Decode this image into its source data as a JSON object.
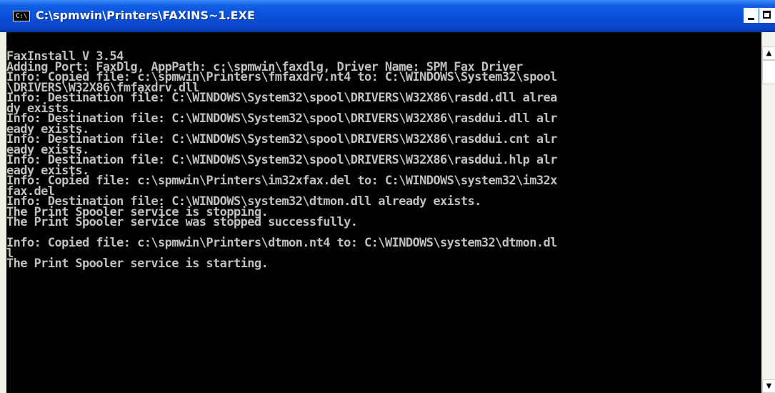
{
  "window": {
    "title": "C:\\spmwin\\Printers\\FAXINS~1.EXE",
    "icon_text": "C:\\",
    "controls": {
      "minimize": "minimize",
      "maximize": "maximize",
      "close": "close"
    }
  },
  "console": {
    "lines": [
      "FaxInstall V 3.54",
      "Adding Port: FaxDlg, AppPath: c:\\spmwin\\faxdlg, Driver Name: SPM Fax Driver",
      "Info: Copied file: c:\\spmwin\\Printers\\fmfaxdrv.nt4 to: C:\\WINDOWS\\System32\\spool",
      "\\DRIVERS\\W32X86\\fmfaxdrv.dll",
      "Info: Destination file: C:\\WINDOWS\\System32\\spool\\DRIVERS\\W32X86\\rasdd.dll alrea",
      "dy exists.",
      "Info: Destination file: C:\\WINDOWS\\System32\\spool\\DRIVERS\\W32X86\\rasddui.dll alr",
      "eady exists.",
      "Info: Destination file: C:\\WINDOWS\\System32\\spool\\DRIVERS\\W32X86\\rasddui.cnt alr",
      "eady exists.",
      "Info: Destination file: C:\\WINDOWS\\System32\\spool\\DRIVERS\\W32X86\\rasddui.hlp alr",
      "eady exists.",
      "Info: Copied file: c:\\spmwin\\Printers\\im32xfax.del to: C:\\WINDOWS\\system32\\im32x",
      "fax.del",
      "Info: Destination file: C:\\WINDOWS\\system32\\dtmon.dll already exists.",
      "The Print Spooler service is stopping.",
      "The Print Spooler service was stopped successfully.",
      "",
      "Info: Copied file: c:\\spmwin\\Printers\\dtmon.nt4 to: C:\\WINDOWS\\system32\\dtmon.dl",
      "l",
      "The Print Spooler service is starting."
    ]
  },
  "scrollbar": {
    "up_arrow": "▲",
    "down_arrow": "▼"
  }
}
